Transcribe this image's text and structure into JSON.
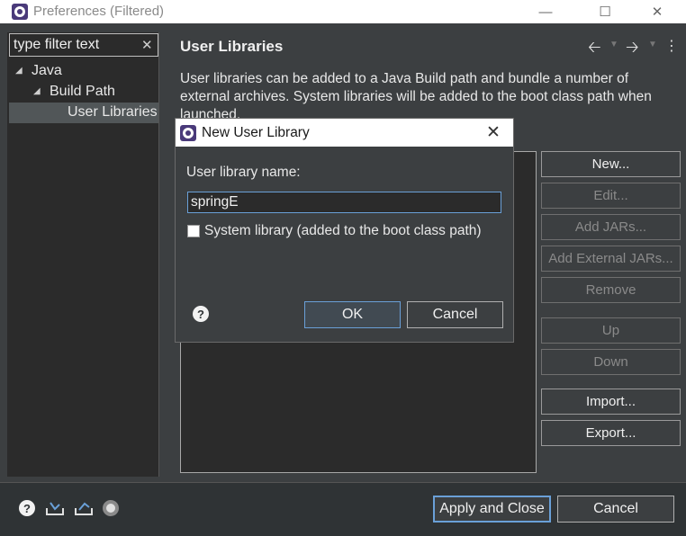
{
  "window": {
    "title": "Preferences (Filtered)",
    "icon": "eclipse-icon",
    "controls": [
      "minimize-icon",
      "maximize-icon",
      "close-icon"
    ]
  },
  "sidebar": {
    "filter_value": "type filter text",
    "tree": [
      {
        "label": "Java",
        "expanded": true,
        "level": 0
      },
      {
        "label": "Build Path",
        "expanded": true,
        "level": 1
      },
      {
        "label": "User Libraries",
        "level": 2,
        "selected": true
      }
    ]
  },
  "page": {
    "title": "User Libraries",
    "description": "User libraries can be added to a Java Build path and bundle a number of external archives. System libraries will be added to the boot class path when launched.",
    "nav_icons": [
      "back-arrow-icon",
      "forward-arrow-icon",
      "view-menu-icon"
    ]
  },
  "buttons": {
    "new": {
      "label": "New...",
      "enabled": true
    },
    "edit": {
      "label": "Edit...",
      "enabled": false
    },
    "add_jars": {
      "label": "Add JARs...",
      "enabled": false
    },
    "add_external_jars": {
      "label": "Add External JARs...",
      "enabled": false
    },
    "remove": {
      "label": "Remove",
      "enabled": false
    },
    "up": {
      "label": "Up",
      "enabled": false
    },
    "down": {
      "label": "Down",
      "enabled": false
    },
    "import": {
      "label": "Import...",
      "enabled": true
    },
    "export": {
      "label": "Export...",
      "enabled": true
    }
  },
  "footer": {
    "apply_close": "Apply and Close",
    "cancel": "Cancel",
    "icons": [
      "help-icon",
      "import-preferences-icon",
      "export-preferences-icon",
      "record-icon"
    ]
  },
  "dialog": {
    "title": "New User Library",
    "name_label": "User library name:",
    "name_value": "springE",
    "system_library_label": "System library (added to the boot class path)",
    "system_library_checked": false,
    "ok": "OK",
    "cancel": "Cancel"
  },
  "colors": {
    "background": "#3c3f41",
    "accent": "#6aa0d8"
  }
}
